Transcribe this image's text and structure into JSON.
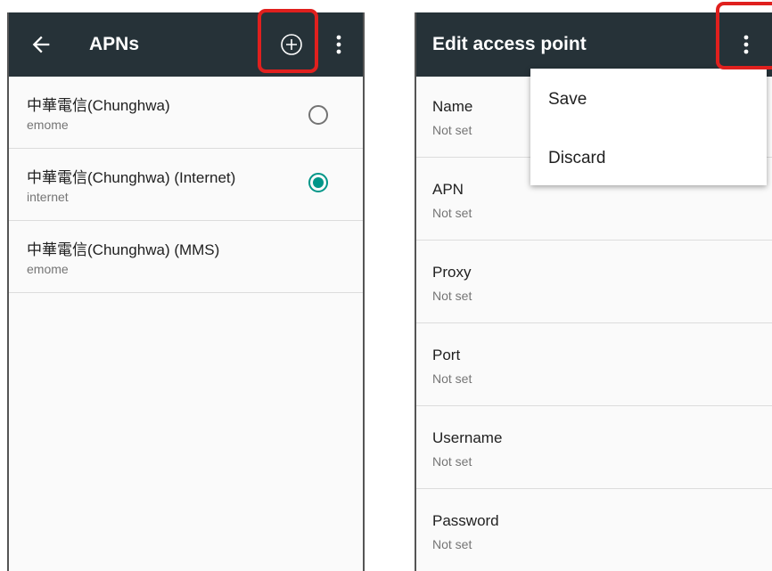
{
  "left": {
    "title": "APNs",
    "icons": [
      "back-arrow",
      "add-circle",
      "more-vertical"
    ],
    "apns": [
      {
        "name": "中華電信(Chunghwa)",
        "apn": "emome",
        "selected": false
      },
      {
        "name": "中華電信(Chunghwa) (Internet)",
        "apn": "internet",
        "selected": true
      },
      {
        "name": "中華電信(Chunghwa) (MMS)",
        "apn": "emome",
        "selected": false
      }
    ]
  },
  "right": {
    "title": "Edit access point",
    "fields": [
      {
        "label": "Name",
        "value": "Not set"
      },
      {
        "label": "APN",
        "value": "Not set"
      },
      {
        "label": "Proxy",
        "value": "Not set"
      },
      {
        "label": "Port",
        "value": "Not set"
      },
      {
        "label": "Username",
        "value": "Not set"
      },
      {
        "label": "Password",
        "value": "Not set"
      }
    ],
    "menu": [
      "Save",
      "Discard"
    ]
  },
  "colors": {
    "appbar": "#263238",
    "accent": "#009688",
    "highlight": "#e0201e"
  }
}
